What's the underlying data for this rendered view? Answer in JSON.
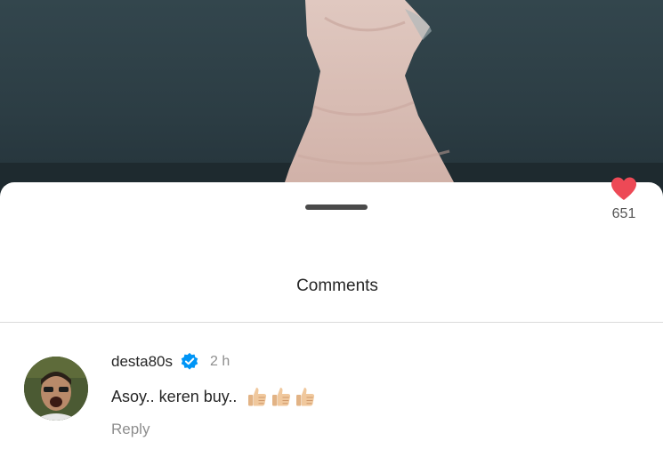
{
  "sheet": {
    "title": "Comments"
  },
  "comment": {
    "username": "desta80s",
    "verified": true,
    "time": "2 h",
    "text": "Asoy.. keren buy..",
    "emoji": [
      "thumbs-up",
      "thumbs-up",
      "thumbs-up"
    ],
    "reply_label": "Reply",
    "like_count": "651",
    "liked": true
  },
  "colors": {
    "heart": "#ed4956",
    "verified_badge": "#0095f6",
    "secondary_text": "#8e8e8e",
    "primary_text": "#262626"
  },
  "icons": {
    "verified": "verified-badge-icon",
    "like": "heart-icon",
    "emoji": "thumbs-up-emoji"
  }
}
